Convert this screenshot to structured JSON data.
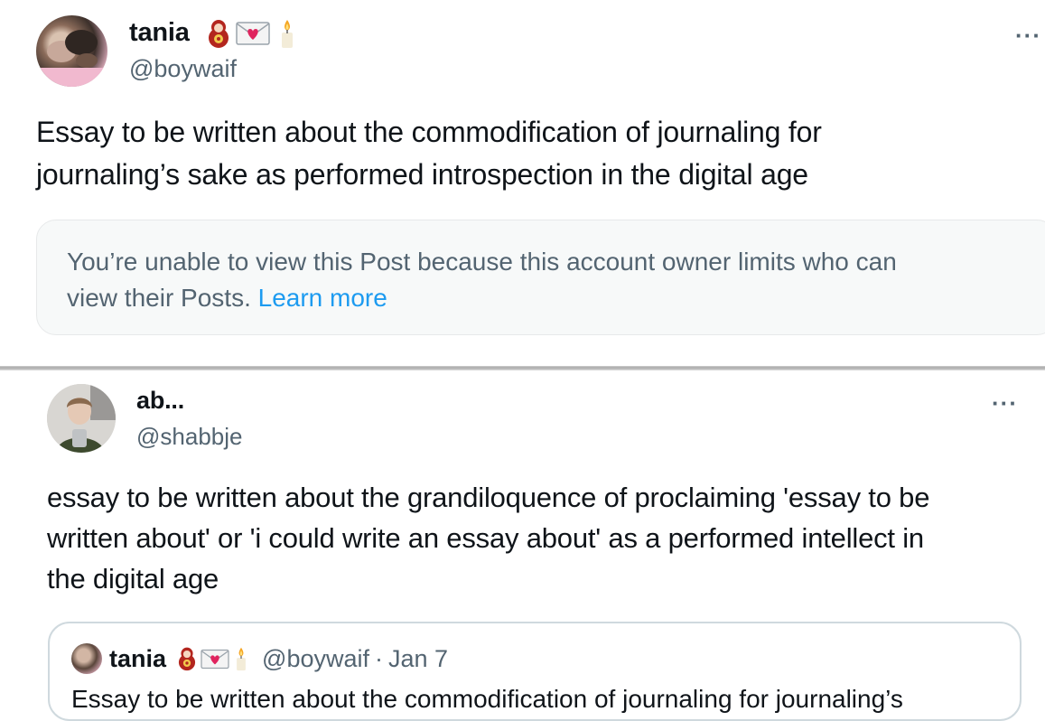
{
  "tweet1": {
    "display_name": "tania",
    "handle": "@boywaif",
    "emojis": [
      "nesting-doll-icon",
      "love-letter-icon",
      "candle-icon"
    ],
    "more_label": "···",
    "text_line1": "Essay to be written about the commodification of journaling for",
    "text_line2": "journaling’s sake as performed introspection in the digital age",
    "notice": {
      "text_line1": "You’re unable to view this Post because this account owner limits who can",
      "text_line2": "view their Posts. ",
      "link": "Learn more"
    }
  },
  "tweet2": {
    "display_name": "ab...",
    "handle": "@shabbje",
    "more_label": "···",
    "text_line1": "essay to be written about the grandiloquence of proclaiming 'essay to be",
    "text_line2": "written about' or 'i could write an essay about' as a performed intellect in",
    "text_line3": "the digital age",
    "quote": {
      "display_name": "tania",
      "handle": "@boywaif",
      "separator": "·",
      "date": "Jan 7",
      "text": "Essay to be written about the commodification of journaling for journaling’s"
    }
  },
  "colors": {
    "text_primary": "#0f1419",
    "text_secondary": "#536471",
    "link": "#1d9bf0",
    "notice_bg": "#f7f9f9",
    "border": "#cfd9de"
  }
}
